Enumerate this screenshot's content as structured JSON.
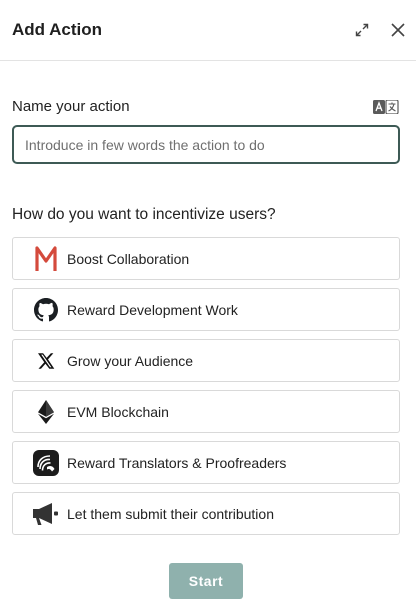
{
  "header": {
    "title": "Add Action"
  },
  "name_field": {
    "label": "Name your action",
    "placeholder": "Introduce in few words the action to do",
    "value": ""
  },
  "incentives": {
    "question": "How do you want to incentivize users?",
    "options": [
      {
        "label": "Boost Collaboration",
        "icon": "m-logo-icon"
      },
      {
        "label": "Reward Development Work",
        "icon": "github-icon"
      },
      {
        "label": "Grow your Audience",
        "icon": "x-logo-icon"
      },
      {
        "label": "EVM Blockchain",
        "icon": "ethereum-icon"
      },
      {
        "label": "Reward Translators & Proofreaders",
        "icon": "translation-logo-icon"
      },
      {
        "label": "Let them submit their contribution",
        "icon": "megaphone-icon"
      }
    ]
  },
  "footer": {
    "start_label": "Start"
  },
  "colors": {
    "input_border": "#3d5a55",
    "start_button_bg": "#8fb1ad",
    "m_logo": "#d44a3c"
  }
}
